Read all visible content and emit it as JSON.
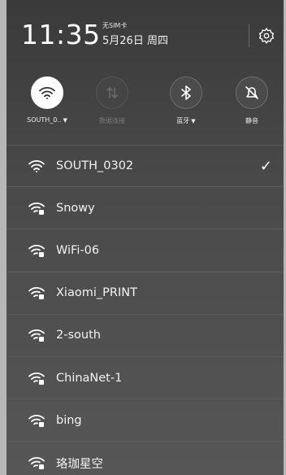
{
  "header": {
    "time": "11:35",
    "sim_status": "无SIM卡",
    "date": "5月26日 周四"
  },
  "toggles": [
    {
      "label": "SOUTH_0..",
      "state": "on",
      "has_caret": true,
      "icon": "wifi-icon"
    },
    {
      "label": "数据连接",
      "state": "disabled",
      "has_caret": false,
      "icon": "mobile-data-icon"
    },
    {
      "label": "蓝牙",
      "state": "off",
      "has_caret": true,
      "icon": "bluetooth-icon"
    },
    {
      "label": "静音",
      "state": "off",
      "has_caret": false,
      "icon": "mute-icon"
    }
  ],
  "wifi_networks": [
    {
      "ssid": "SOUTH_0302",
      "connected": true,
      "locked": false
    },
    {
      "ssid": "Snowy",
      "connected": false,
      "locked": true
    },
    {
      "ssid": "WiFi-06",
      "connected": false,
      "locked": true
    },
    {
      "ssid": "Xiaomi_PRINT",
      "connected": false,
      "locked": true
    },
    {
      "ssid": "2-south",
      "connected": false,
      "locked": true
    },
    {
      "ssid": "ChinaNet-1",
      "connected": false,
      "locked": true
    },
    {
      "ssid": "bing",
      "connected": false,
      "locked": true
    },
    {
      "ssid": "珞珈星空",
      "connected": false,
      "locked": true
    }
  ],
  "colors": {
    "panel_top": "#3a3a3a",
    "panel_bottom": "#565656",
    "text": "#ffffff",
    "disabled_text": "#7a7a7a"
  }
}
